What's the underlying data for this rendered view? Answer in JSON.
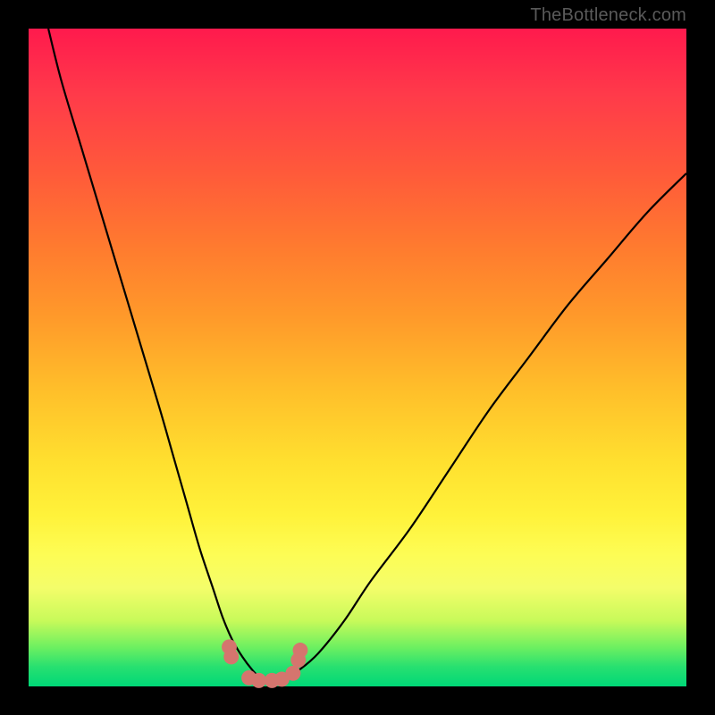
{
  "attribution": "TheBottleneck.com",
  "colors": {
    "frame": "#000000",
    "curve": "#000000",
    "marker": "#d5756e"
  },
  "chart_data": {
    "type": "line",
    "title": "",
    "xlabel": "",
    "ylabel": "",
    "xlim": [
      0,
      100
    ],
    "ylim": [
      0,
      100
    ],
    "grid": false,
    "legend": false,
    "series": [
      {
        "name": "left-branch",
        "x": [
          3,
          5,
          8,
          11,
          14,
          17,
          20,
          22,
          24,
          26,
          28,
          29.5,
          31,
          32.5,
          34,
          35,
          36
        ],
        "y": [
          100,
          92,
          82,
          72,
          62,
          52,
          42,
          35,
          28,
          21,
          15,
          10.5,
          7,
          4.5,
          2.5,
          1.5,
          1
        ]
      },
      {
        "name": "valley-floor",
        "x": [
          33,
          34,
          35,
          36,
          37,
          38,
          39,
          40,
          41
        ],
        "y": [
          2.0,
          1.2,
          0.8,
          0.6,
          0.6,
          0.7,
          1.0,
          1.6,
          2.4
        ]
      },
      {
        "name": "right-branch",
        "x": [
          39,
          41,
          44,
          48,
          52,
          58,
          64,
          70,
          76,
          82,
          88,
          94,
          100
        ],
        "y": [
          1.2,
          2.4,
          5,
          10,
          16,
          24,
          33,
          42,
          50,
          58,
          65,
          72,
          78
        ]
      }
    ],
    "markers": {
      "name": "peach-dots",
      "x": [
        30.5,
        30.8,
        33.5,
        35.0,
        37.0,
        38.5,
        40.2,
        41.0,
        41.3
      ],
      "y": [
        6.0,
        4.5,
        1.3,
        0.9,
        0.9,
        1.1,
        2.0,
        4.0,
        5.5
      ]
    },
    "gradient_stops": [
      {
        "pos": 0,
        "color": "#ff1a4d"
      },
      {
        "pos": 33,
        "color": "#ff7a2f"
      },
      {
        "pos": 66,
        "color": "#ffe02f"
      },
      {
        "pos": 85,
        "color": "#f4fd6a"
      },
      {
        "pos": 100,
        "color": "#00d877"
      }
    ]
  }
}
